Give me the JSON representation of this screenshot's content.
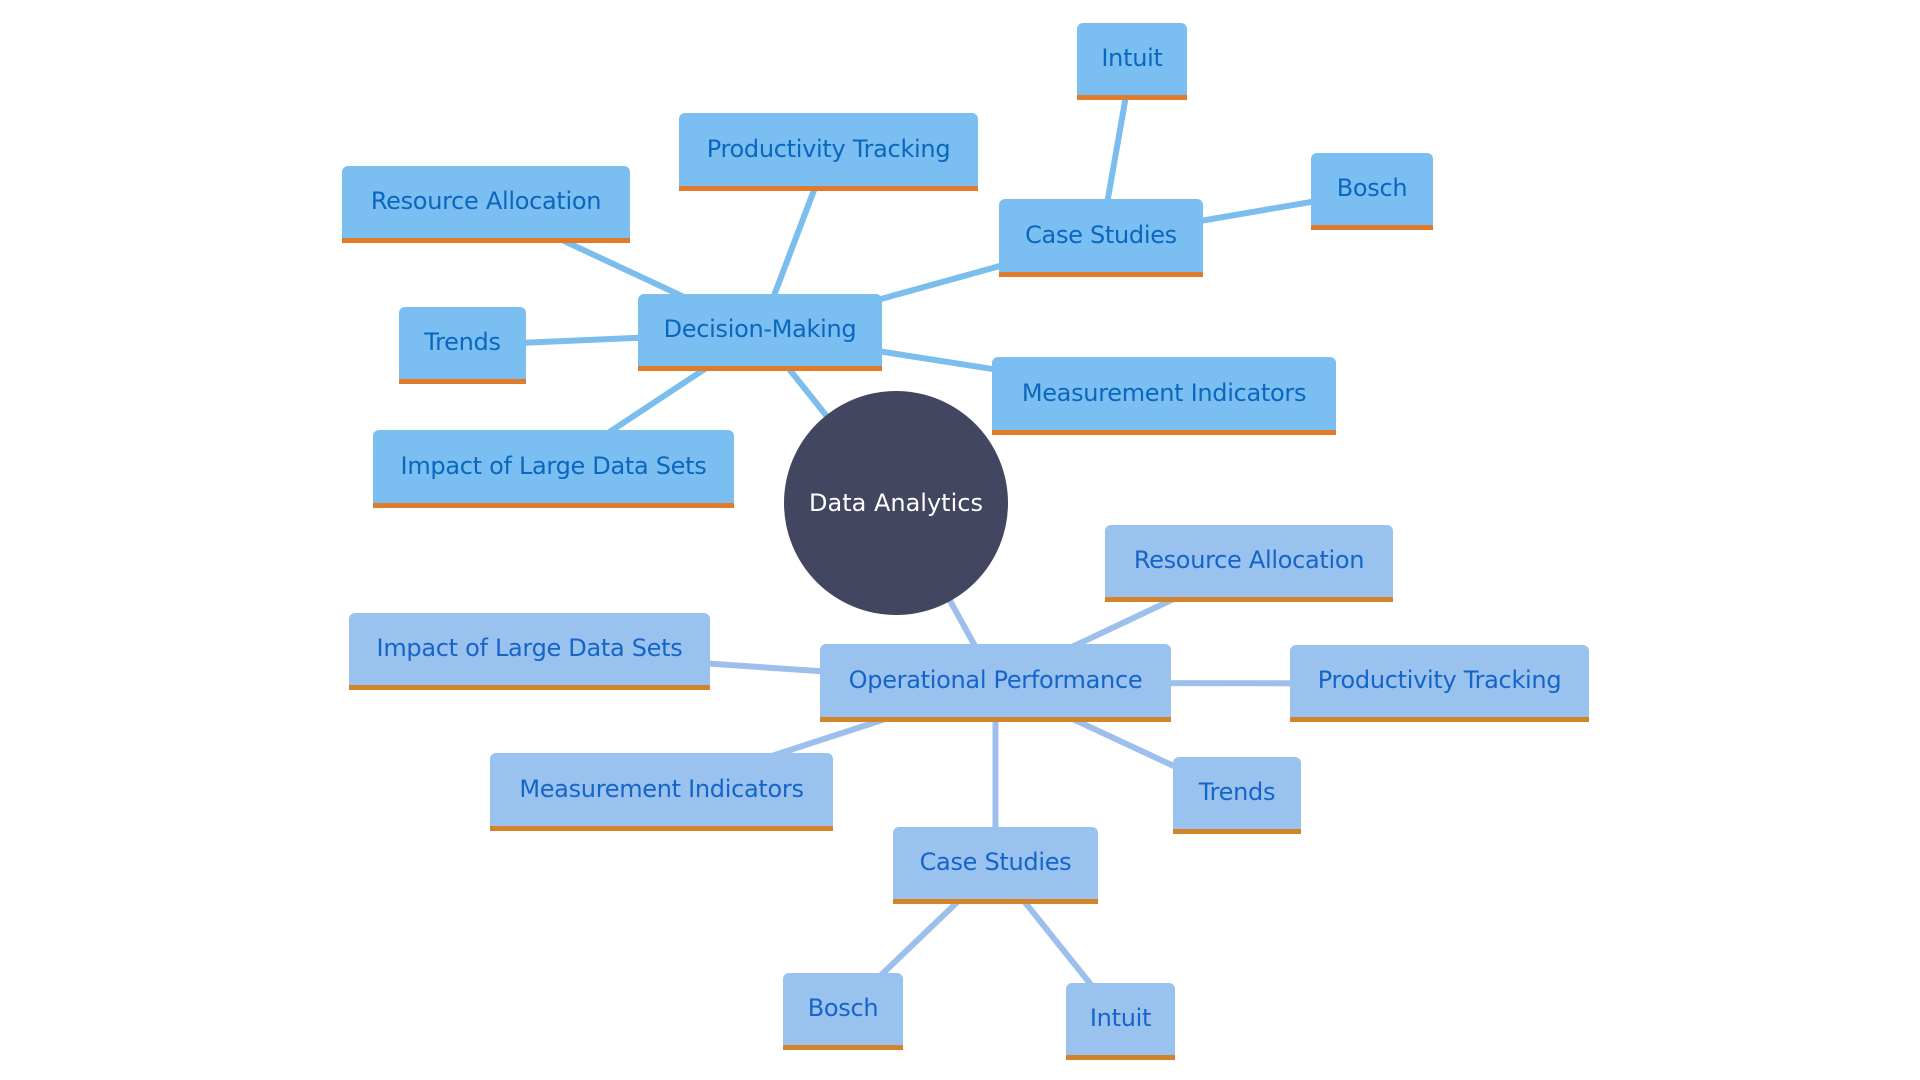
{
  "root": {
    "id": "root",
    "label": "Data Analytics"
  },
  "colors": {
    "root_fill": "#424660",
    "top_fill": "#7BBFF2",
    "top_text": "#0B66BE",
    "top_accent": "#E07B2C",
    "top_edge": "#7BBDED",
    "bottom_fill": "#9AC2EE",
    "bottom_text": "#1565C8",
    "bottom_accent": "#D4832B",
    "bottom_edge": "#9CC0EB"
  },
  "branches": [
    {
      "id": "decision-making",
      "label": "Decision-Making",
      "children": [
        {
          "id": "dm-resource-allocation",
          "label": "Resource Allocation"
        },
        {
          "id": "dm-productivity-tracking",
          "label": "Productivity Tracking"
        },
        {
          "id": "dm-case-studies",
          "label": "Case Studies",
          "children": [
            {
              "id": "dm-cs-intuit",
              "label": "Intuit"
            },
            {
              "id": "dm-cs-bosch",
              "label": "Bosch"
            }
          ]
        },
        {
          "id": "dm-trends",
          "label": "Trends"
        },
        {
          "id": "dm-measurement-indicators",
          "label": "Measurement Indicators"
        },
        {
          "id": "dm-impact-large-data-sets",
          "label": "Impact of Large Data Sets"
        }
      ]
    },
    {
      "id": "operational-performance",
      "label": "Operational Performance",
      "children": [
        {
          "id": "op-resource-allocation",
          "label": "Resource Allocation"
        },
        {
          "id": "op-productivity-tracking",
          "label": "Productivity Tracking"
        },
        {
          "id": "op-impact-large-data-sets",
          "label": "Impact of Large Data Sets"
        },
        {
          "id": "op-measurement-indicators",
          "label": "Measurement Indicators"
        },
        {
          "id": "op-trends",
          "label": "Trends"
        },
        {
          "id": "op-case-studies",
          "label": "Case Studies",
          "children": [
            {
              "id": "op-cs-bosch",
              "label": "Bosch"
            },
            {
              "id": "op-cs-intuit",
              "label": "Intuit"
            }
          ]
        }
      ]
    }
  ]
}
